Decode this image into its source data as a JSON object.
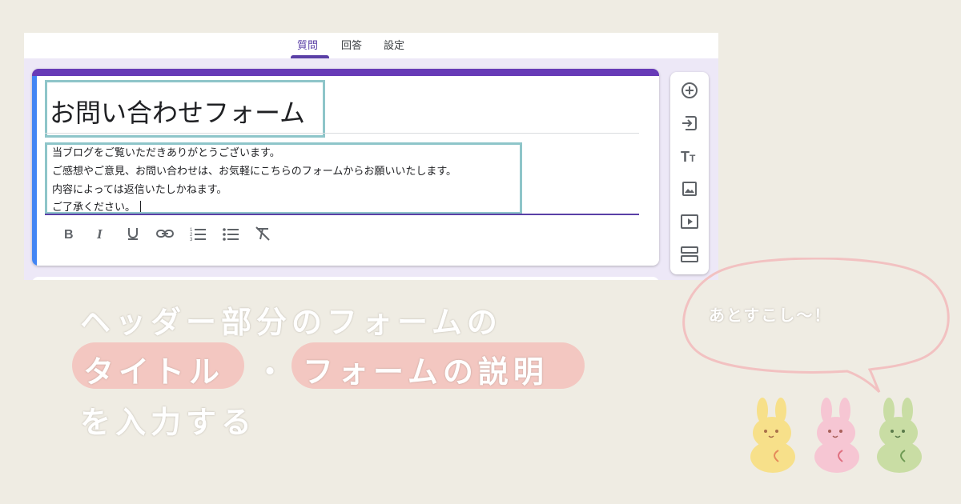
{
  "tabs": [
    {
      "label": "質問",
      "active": true
    },
    {
      "label": "回答",
      "active": false
    },
    {
      "label": "設定",
      "active": false
    }
  ],
  "form": {
    "title": "お問い合わせフォーム",
    "description_lines": [
      "当ブログをご覧いただきありがとうございます。",
      "ご感想やご意見、お問い合わせは、お気軽にこちらのフォームからお願いいたします。",
      "内容によっては返信いたしかねます。",
      "ご了承ください。"
    ]
  },
  "format_toolbar": [
    "bold-icon",
    "italic-icon",
    "underline-icon",
    "link-icon",
    "numbered-list-icon",
    "bulleted-list-icon",
    "clear-format-icon"
  ],
  "side_toolbar": [
    "add-question-icon",
    "import-questions-icon",
    "add-title-icon",
    "add-image-icon",
    "add-video-icon",
    "add-section-icon"
  ],
  "caption": {
    "line1": "ヘッダー部分のフォームの",
    "highlight1": "タイトル",
    "separator": "・",
    "highlight2": "フォームの説明",
    "line3": "を入力する"
  },
  "bubble": {
    "text": "あとすこし〜！"
  },
  "colors": {
    "background": "#efece3",
    "accent_purple": "#673ab7",
    "highlight_box": "#8ec5c9",
    "pill": "#f3c7c1",
    "rabbit_yellow": "#f7e08a",
    "rabbit_pink": "#f6c6d3",
    "rabbit_green": "#c9dda4"
  }
}
